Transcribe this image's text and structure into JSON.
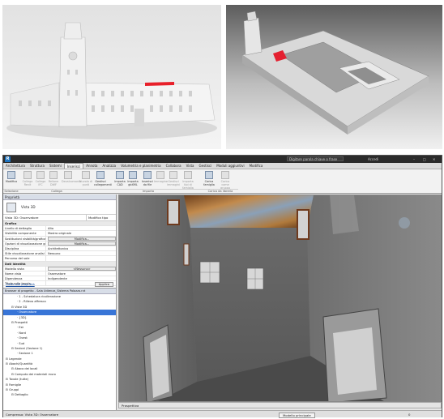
{
  "app": {
    "window_title": "",
    "search_placeholder": "Digitare parola chiave o frase",
    "user_label": "Accedi"
  },
  "ribbon": {
    "tabs": [
      "Architettura",
      "Struttura",
      "Sistemi",
      "Inserisci",
      "Annota",
      "Analizza",
      "Volumetria e planimetria",
      "Collabora",
      "Vista",
      "Gestisci",
      "Moduli aggiuntivi",
      "Modifica"
    ],
    "active_tab": "Inserisci",
    "buttons": [
      {
        "label": "Modifica",
        "enabled": true
      },
      {
        "label": "Collega Revit",
        "enabled": false
      },
      {
        "label": "Collega IFC",
        "enabled": false
      },
      {
        "label": "Reliane DWF",
        "enabled": false
      },
      {
        "label": "Decalcomania",
        "enabled": false
      },
      {
        "label": "Nuvola di punti",
        "enabled": false
      },
      {
        "label": "Gestisci collegamenti",
        "enabled": true
      },
      {
        "label": "Importa CAD",
        "enabled": true
      },
      {
        "label": "Importa gbXML",
        "enabled": true
      },
      {
        "label": "Inserisci da file",
        "enabled": true
      },
      {
        "label": "Immagine",
        "enabled": false
      },
      {
        "label": "Gestisci immagini",
        "enabled": false
      },
      {
        "label": "Importa tipi di famiglia",
        "enabled": false
      },
      {
        "label": "Carica famiglia",
        "enabled": true
      },
      {
        "label": "Carica come gruppo",
        "enabled": false
      }
    ],
    "groups": [
      "Selezione",
      "Collega",
      "Importa",
      "Carica da libreria"
    ]
  },
  "properties": {
    "header": "Proprietà",
    "type_name": "Vista 3D",
    "edit_type_label": "Modifica tipo",
    "instance_dropdown": "Vista 3D: Osservatore",
    "rows": [
      {
        "section": "Grafica"
      },
      {
        "k": "Livello di dettaglio",
        "v": "Alto"
      },
      {
        "k": "Visibilità componente",
        "v": "Mostra originale"
      },
      {
        "k": "Sostituzioni visibilità/grafica",
        "v": "Modifica...",
        "button": true
      },
      {
        "k": "Opzioni di visualizzazione grafica",
        "v": "Modifica...",
        "button": true
      },
      {
        "k": "Disciplina",
        "v": "Architettonico"
      },
      {
        "k": "Stile visualizzazione analisi di default",
        "v": "Nessuno"
      },
      {
        "k": "Percorso del sole",
        "v": ""
      },
      {
        "section": "Dati identità"
      },
      {
        "k": "Modello vista",
        "v": "<Nessuno>",
        "button": true
      },
      {
        "k": "Nome vista",
        "v": "Osservatore"
      },
      {
        "k": "Dipendenza",
        "v": "Indipendente"
      },
      {
        "k": "Titolo sulla tavola",
        "v": ""
      }
    ],
    "help_link": "Guida alle proprietà",
    "apply_label": "Applica"
  },
  "browser": {
    "header": "Browser di progetto - Sala Udienza_Sistema Palazzo.rvt",
    "items": [
      {
        "depth": 2,
        "label": "1 - Schedatura ricollerazione"
      },
      {
        "depth": 2,
        "label": "2 - Rilievo affresco"
      },
      {
        "depth": 1,
        "label": "Viste 3D"
      },
      {
        "depth": 2,
        "label": "Osservatore",
        "selected": true
      },
      {
        "depth": 2,
        "label": "{3D}"
      },
      {
        "depth": 1,
        "label": "Prospetti"
      },
      {
        "depth": 2,
        "label": "Est"
      },
      {
        "depth": 2,
        "label": "Nord"
      },
      {
        "depth": 2,
        "label": "Ovest"
      },
      {
        "depth": 2,
        "label": "Sud"
      },
      {
        "depth": 1,
        "label": "Sezioni (Sezione 1)"
      },
      {
        "depth": 2,
        "label": "Sezione 1"
      },
      {
        "depth": 0,
        "label": "Legende"
      },
      {
        "depth": 0,
        "label": "Abachi/Quantità"
      },
      {
        "depth": 1,
        "label": "Abaco dei locali"
      },
      {
        "depth": 1,
        "label": "Computo dei materiali muro"
      },
      {
        "depth": 0,
        "label": "Tavole (tutte)"
      },
      {
        "depth": 0,
        "label": "Famiglie"
      },
      {
        "depth": 0,
        "label": "Gruppi"
      },
      {
        "depth": 1,
        "label": "Dettaglio"
      }
    ]
  },
  "viewport": {
    "view_type": "Prospettiva"
  },
  "statusbar": {
    "left_text": "Compresso: Vista 3D: Osservatore",
    "model_label": "Modello principale",
    "counter": "0"
  }
}
